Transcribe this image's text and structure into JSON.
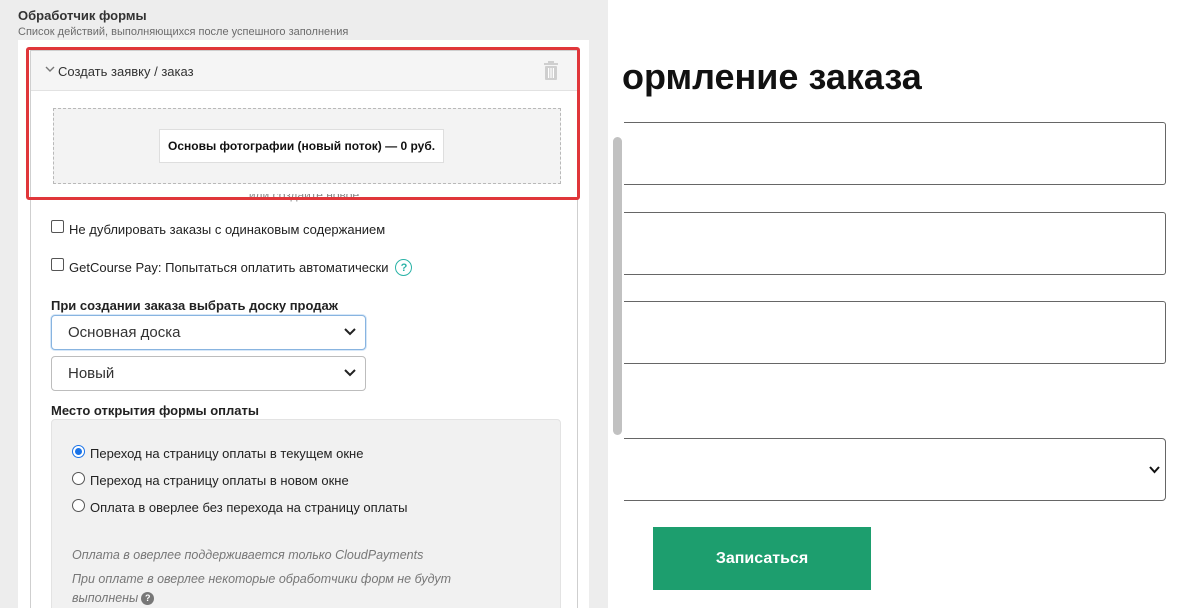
{
  "form_handler": {
    "title": "Обработчик формы",
    "subtitle": "Список действий, выполняющихся после успешного заполнения"
  },
  "action": {
    "title": "Создать заявку / заказ",
    "offer_label": "Основы фотографии (новый поток) — 0 руб.",
    "create_new_link": "или создайте новое"
  },
  "options": {
    "no_duplicate": "Не дублировать заказы с одинаковым содержанием",
    "getcourse_pay": "GetCourse Pay: Попытаться оплатить автоматически"
  },
  "deal_board": {
    "label": "При создании заказа выбрать доску продаж",
    "board_value": "Основная доска",
    "stage_value": "Новый"
  },
  "payment_place": {
    "label": "Место открытия формы оплаты",
    "options": [
      "Переход на страницу оплаты в текущем окне",
      "Переход на страницу оплаты в новом окне",
      "Оплата в оверлее без перехода на страницу оплаты"
    ],
    "selected_index": 0,
    "note_1": "Оплата в оверлее поддерживается только CloudPayments",
    "note_2": "При оплате в оверлее некоторые обработчики форм не будут выполнены"
  },
  "page_preview": {
    "title": "ормление заказа",
    "submit_label": "Записаться"
  },
  "colors": {
    "highlight_outline": "#e0363a",
    "submit_button": "#1d9e6e",
    "help_icon": "#2bb3a7",
    "radio_checked": "#1a73e8"
  },
  "icons": {
    "collapse": "chevron-down-icon",
    "delete": "trash-icon",
    "help": "question-circle-icon",
    "select_caret": "chevron-down-icon"
  }
}
